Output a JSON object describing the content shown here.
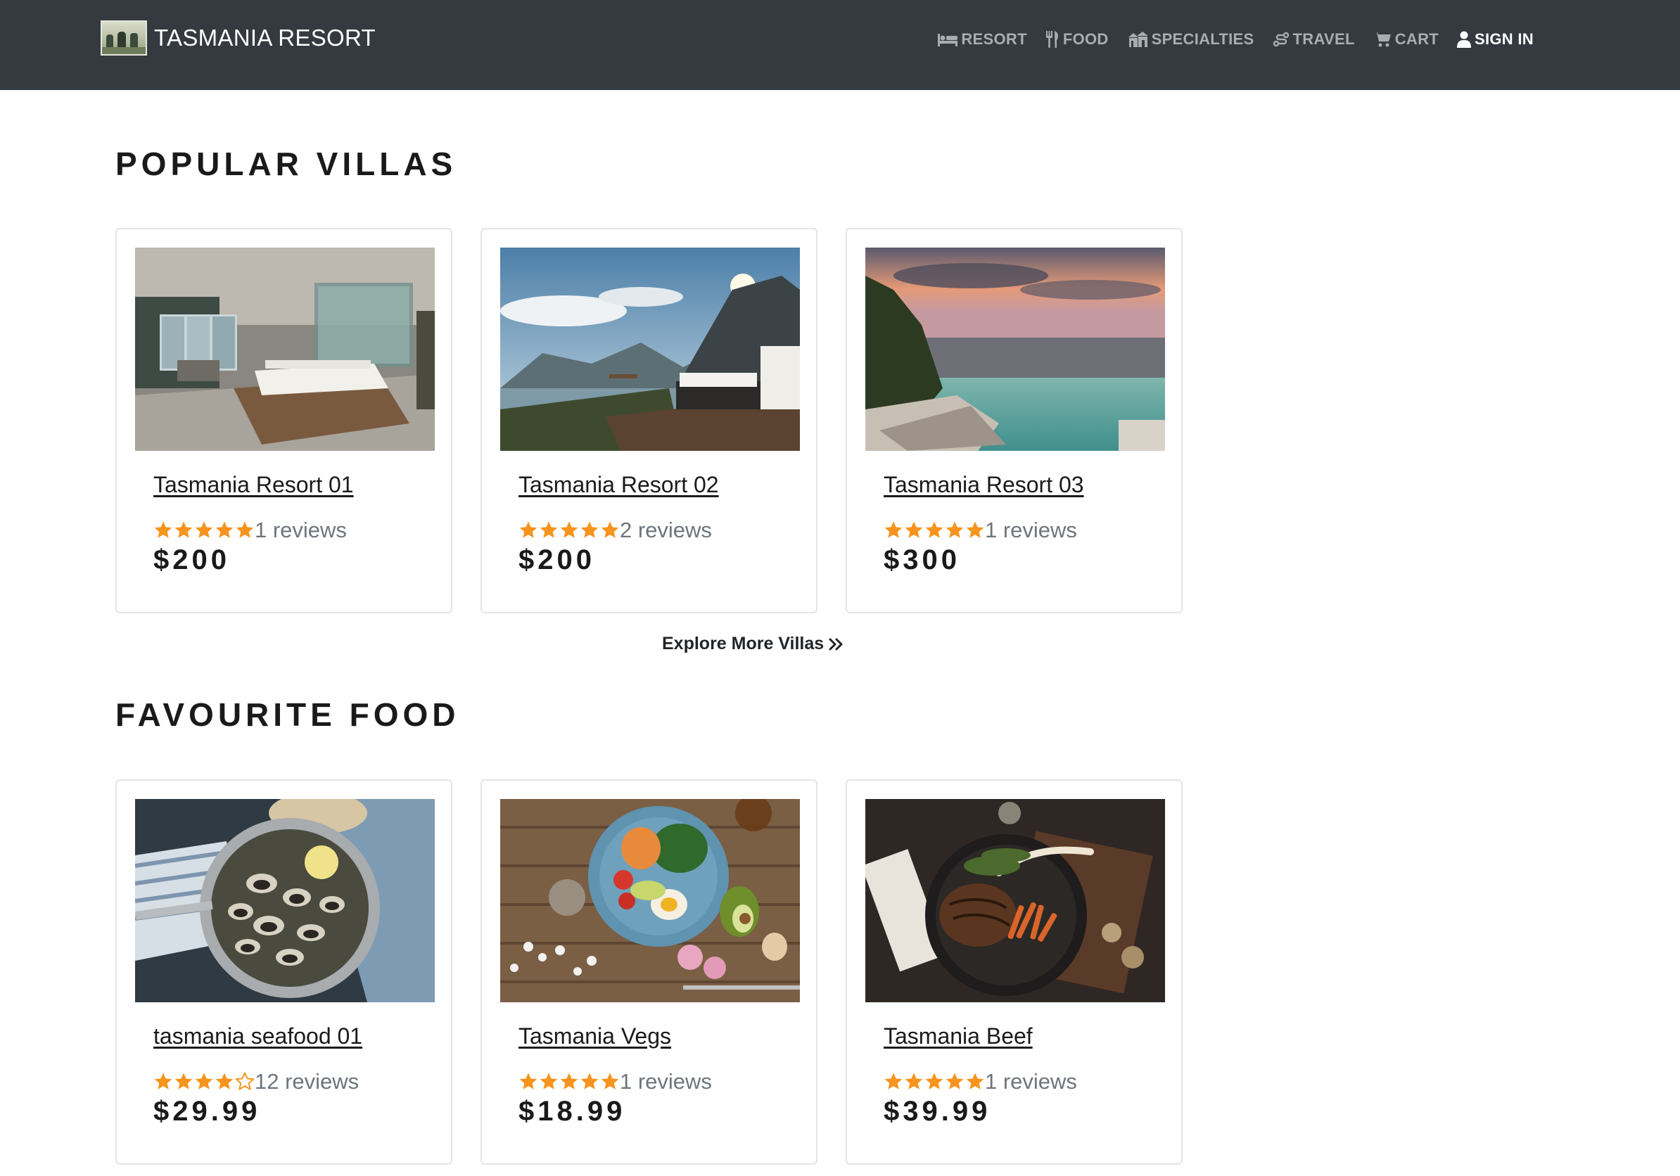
{
  "header": {
    "brand": "TASMANIA RESORT",
    "nav": [
      {
        "label": "RESORT",
        "icon": "bed-icon"
      },
      {
        "label": "FOOD",
        "icon": "utensils-icon"
      },
      {
        "label": "SPECIALTIES",
        "icon": "landmark-icon"
      },
      {
        "label": "TRAVEL",
        "icon": "route-icon"
      },
      {
        "label": "CART",
        "icon": "cart-icon"
      },
      {
        "label": "SIGN IN",
        "icon": "user-icon"
      }
    ]
  },
  "villas": {
    "title": "POPULAR VILLAS",
    "items": [
      {
        "name": "Tasmania Resort 01",
        "rating": 5,
        "reviews": "1 reviews",
        "price": "$200",
        "image": "modern villa bedroom"
      },
      {
        "name": "Tasmania Resort 02",
        "rating": 5,
        "reviews": "2 reviews",
        "price": "$200",
        "image": "mountain deck bed"
      },
      {
        "name": "Tasmania Resort 03",
        "rating": 5,
        "reviews": "1 reviews",
        "price": "$300",
        "image": "infinity pool sunset"
      }
    ],
    "explore_label": "Explore More Villas"
  },
  "food": {
    "title": "FAVOURITE FOOD",
    "items": [
      {
        "name": "tasmania seafood 01",
        "rating": 4,
        "reviews": "12 reviews",
        "price": "$29.99",
        "image": "clams in pan"
      },
      {
        "name": "Tasmania Vegs",
        "rating": 5,
        "reviews": "1 reviews",
        "price": "$18.99",
        "image": "salad bowl"
      },
      {
        "name": "Tasmania Beef",
        "rating": 5,
        "reviews": "1 reviews",
        "price": "$39.99",
        "image": "steak in skillet"
      }
    ]
  },
  "colors": {
    "navbar": "#343a40",
    "star": "#f7941d",
    "nav_text": "#a9adb1",
    "nav_active": "#ffffff"
  }
}
